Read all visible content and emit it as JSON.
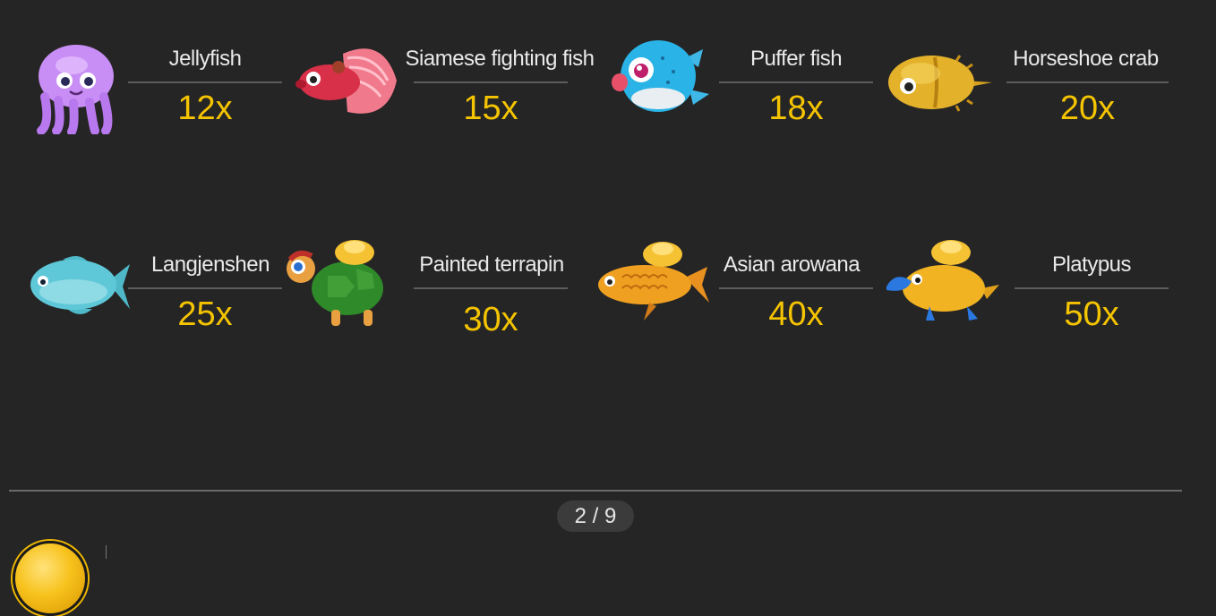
{
  "paytable": {
    "rows": [
      [
        {
          "name": "Jellyfish",
          "multiplier": "12x",
          "icon": "jellyfish-icon",
          "color": "#c88ef5"
        },
        {
          "name": "Siamese fighting fish",
          "multiplier": "15x",
          "icon": "betta-fish-icon",
          "color": "#e8506a"
        },
        {
          "name": "Puffer fish",
          "multiplier": "18x",
          "icon": "puffer-fish-icon",
          "color": "#2ab3e6"
        },
        {
          "name": "Horseshoe crab",
          "multiplier": "20x",
          "icon": "horseshoe-crab-icon",
          "color": "#e3b12a"
        }
      ],
      [
        {
          "name": "Langjenshen",
          "multiplier": "25x",
          "icon": "langjenshen-fish-icon",
          "color": "#5fc8d8"
        },
        {
          "name": "Painted terrapin",
          "multiplier": "30x",
          "icon": "terrapin-icon",
          "color": "#2f8a2a"
        },
        {
          "name": "Asian arowana",
          "multiplier": "40x",
          "icon": "arowana-icon",
          "color": "#f0a020"
        },
        {
          "name": "Platypus",
          "multiplier": "50x",
          "icon": "platypus-icon",
          "color": "#f2b322"
        }
      ]
    ]
  },
  "pagination": {
    "label": "2 / 9"
  },
  "colors": {
    "background": "#252525",
    "label": "#e9e9e9",
    "multiplier": "#f5c400",
    "underline": "#5d5d5d"
  }
}
